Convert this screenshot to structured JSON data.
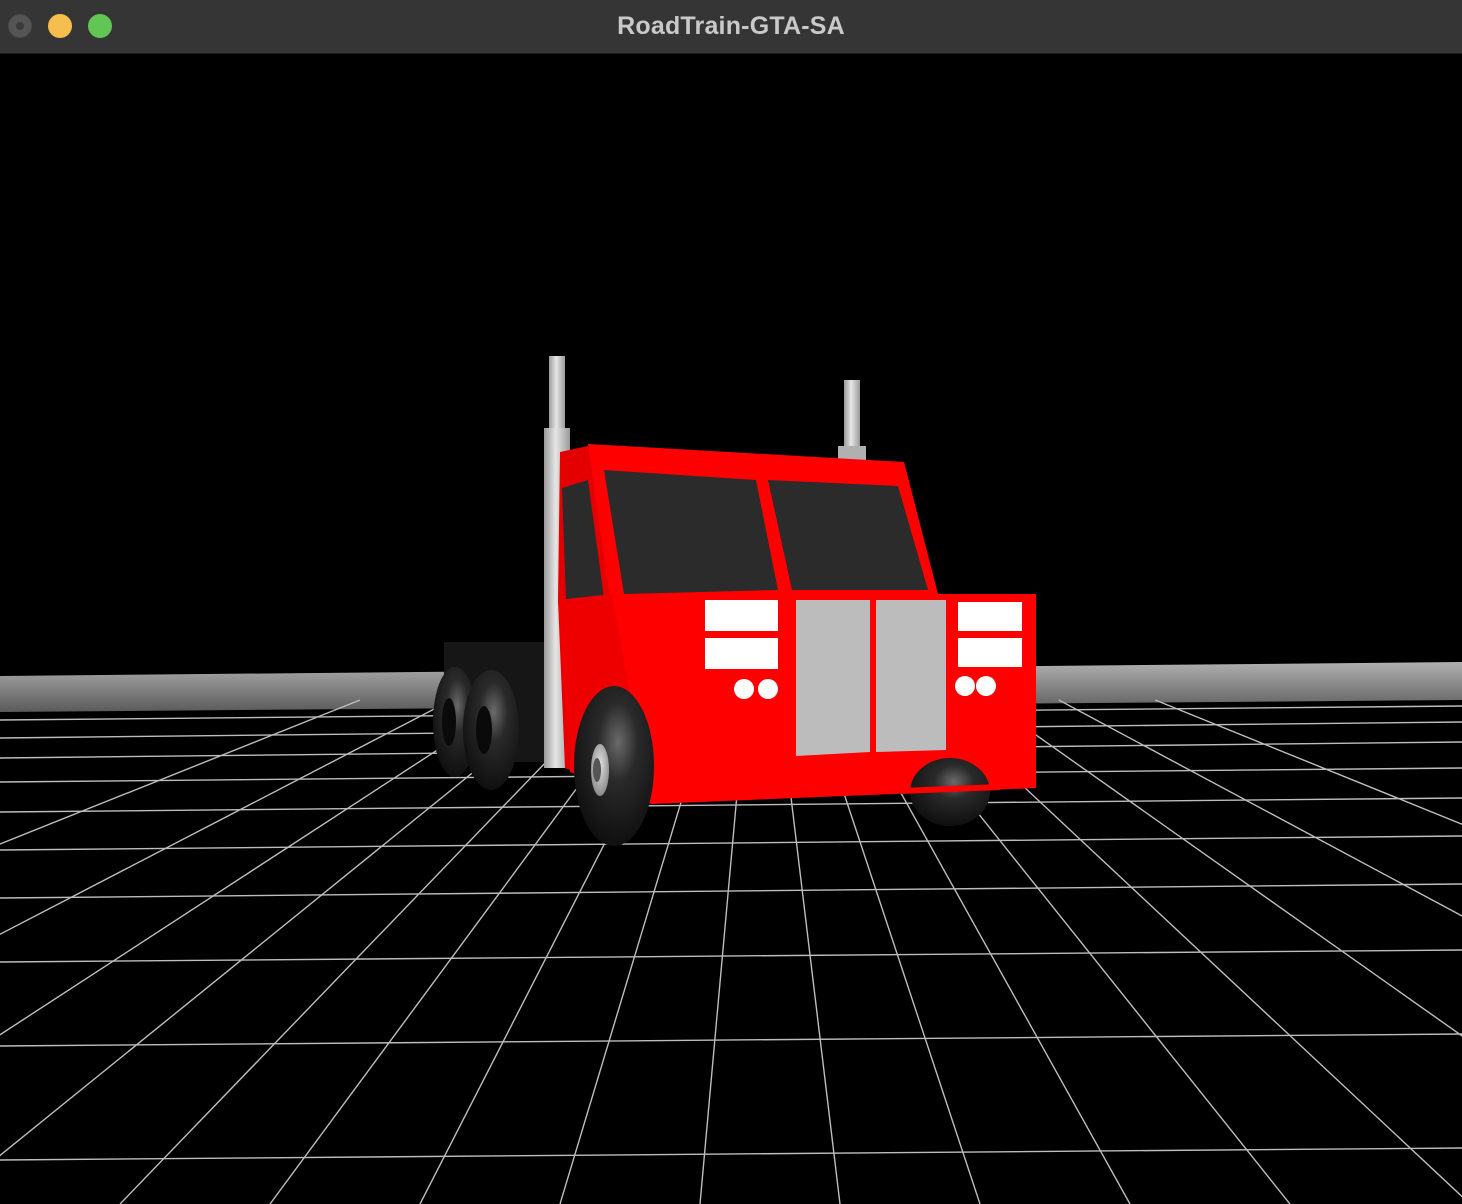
{
  "window": {
    "title": "RoadTrain-GTA-SA",
    "buttons": [
      "close",
      "minimize",
      "zoom"
    ]
  },
  "scene": {
    "background": "#000000",
    "ground": "wireframe-grid",
    "grid_color": "#bdbdbd",
    "model": "road-train-truck-cab",
    "cab_color": "#ff0000",
    "glass_color": "#2b2b2b",
    "grille_color": "#bcbcbc",
    "tire_color": "#1a1a1a",
    "exhaust_color": "#d0d0d0"
  }
}
